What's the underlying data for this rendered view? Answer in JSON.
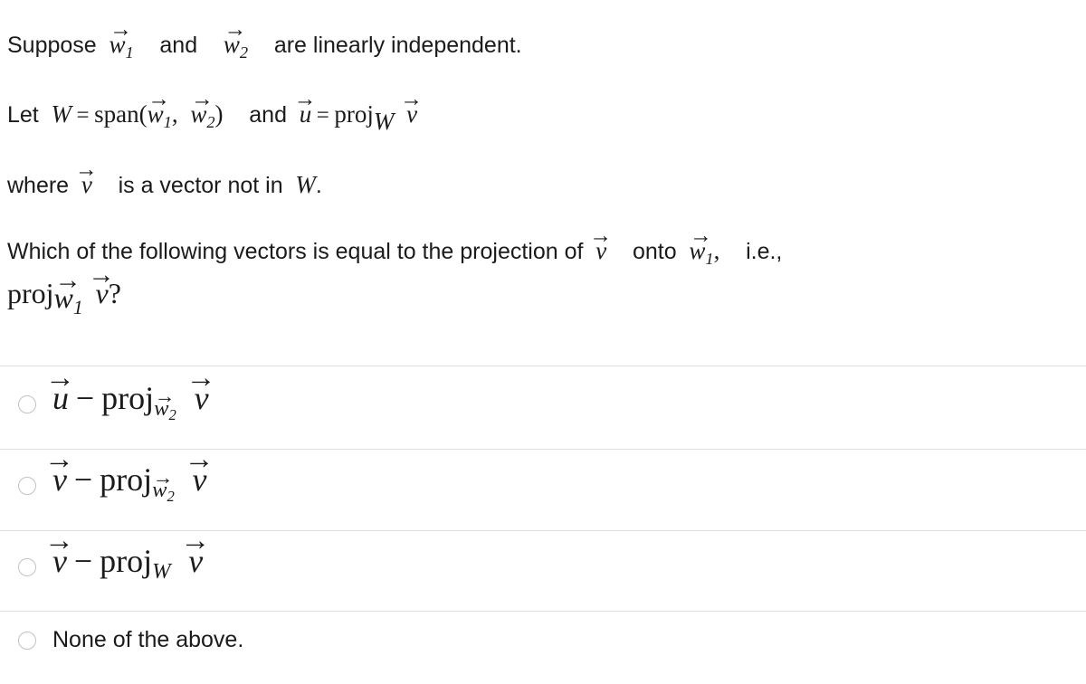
{
  "question": {
    "premise_line_1": {
      "before": "Suppose",
      "var_a": "w",
      "var_a_sub": "1",
      "middle": "and",
      "var_b": "w",
      "var_b_sub": "2",
      "after": "are linearly independent."
    },
    "premise_line_2": {
      "before": "Let",
      "set_name": "W",
      "equals": "=",
      "span_op": "span",
      "open_paren": "(",
      "arg1": "w",
      "arg1_sub": "1",
      "comma": ",",
      "arg2": "w",
      "arg2_sub": "2",
      "close_paren": ")",
      "conjunction": "and",
      "u_var": "u",
      "equals2": "=",
      "proj_op": "proj",
      "proj_sub": "W",
      "proj_arg": "v"
    },
    "premise_line_3": {
      "before": "where",
      "var": "v",
      "middle": "is a vector not in",
      "set_name": "W",
      "period": "."
    },
    "prompt_line_1": {
      "text_a": "Which of the following vectors is equal to the projection of",
      "var_v": "v",
      "text_b": "onto",
      "var_w": "w",
      "var_w_sub": "1",
      "comma": ",",
      "text_c": "i.e.,"
    },
    "prompt_line_2": {
      "proj_op": "proj",
      "proj_sub_var": "w",
      "proj_sub_index": "1",
      "proj_arg": "v",
      "question_mark": "?"
    }
  },
  "options": [
    {
      "id": "option-a",
      "kind": "math",
      "selected": false,
      "left_var": "u",
      "minus": "−",
      "proj_op": "proj",
      "proj_sub_var": "w",
      "proj_sub_index": "2",
      "proj_arg": "v",
      "plain_text": "u⃗ − proj_{w⃗₂} v⃗"
    },
    {
      "id": "option-b",
      "kind": "math",
      "selected": false,
      "left_var": "v",
      "minus": "−",
      "proj_op": "proj",
      "proj_sub_var": "w",
      "proj_sub_index": "2",
      "proj_arg": "v",
      "plain_text": "v⃗ − proj_{w⃗₂} v⃗"
    },
    {
      "id": "option-c",
      "kind": "math",
      "selected": false,
      "left_var": "v",
      "minus": "−",
      "proj_op": "proj",
      "proj_sub_var": "W",
      "proj_sub_index": "",
      "proj_arg": "v",
      "plain_text": "v⃗ − proj_W v⃗"
    },
    {
      "id": "option-d",
      "kind": "plain",
      "selected": false,
      "label": "None of the above."
    }
  ],
  "glyphs": {
    "vector_arrow": "→",
    "minus": "−",
    "equals": "="
  },
  "colors": {
    "background": "#ffffff",
    "text": "#1b1b1b",
    "divider": "#dededf",
    "radio_border": "#c2c2c2"
  }
}
